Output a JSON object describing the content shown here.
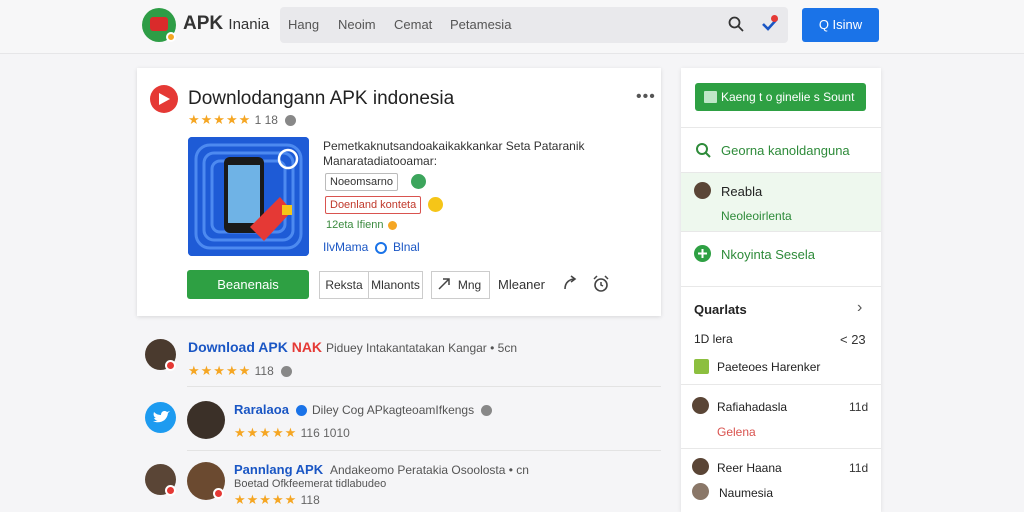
{
  "header": {
    "brand": "APK",
    "brand_suffix": "Inania",
    "nav": [
      "Hang",
      "Neoim",
      "Cemat",
      "Petamesia"
    ],
    "login_label": "Q Isinw"
  },
  "app": {
    "title": "Downlodangann APK indonesia",
    "rating_text": "1 18",
    "description": "Pemetkaknutsandoakaikakkankar Seta Pataranik Manaratadiatooamar:",
    "tag1": "Noeomsarno",
    "tag2": "Doenland konteta",
    "status": "12eta Ifienn",
    "developer": "IlvMama",
    "developer_suffix": "Blnal",
    "download_label": "Beanenais",
    "seg1": "Reksta",
    "seg2": "Mlanonts",
    "link1": "Mng",
    "link2": "Mleaner"
  },
  "results": [
    {
      "title": "Download APK",
      "title_accent": "NAK",
      "sub": "Piduey Intakantatakan Kangar • 5cn",
      "meta": "118"
    },
    {
      "title": "Raralaoa",
      "sub": "Diley Cog APkagteoamIfkengs",
      "meta": "116 1010"
    },
    {
      "title": "Pannlang APK",
      "sub": "Andakeomo Peratakia Osoolosta • cn",
      "sub2": "Boetad Ofkfeemerat tidlabudeo",
      "meta": "118"
    }
  ],
  "sidebar": {
    "button_label": "Kaeng t o ginelie s Sount",
    "item1": "Georna kanoldanguna",
    "item2_title": "Reabla",
    "item2_sub": "Neoleoirlenta",
    "item3": "Nkoyinta Sesela",
    "section": "Quarlats",
    "row1_label": "1D lera",
    "row1_val": "< 23",
    "row2_label": "Paeteoes Harenker",
    "row3_label": "Rafiahadasla",
    "row3_sub": "Gelena",
    "row3_val": "11d",
    "row4_label": "Reer Haana",
    "row4_val": "11d",
    "row5_label": "Naumesia"
  },
  "colors": {
    "primary_blue": "#1a73e8",
    "green": "#2ea043",
    "red": "#e53935",
    "star": "#f5a623"
  }
}
